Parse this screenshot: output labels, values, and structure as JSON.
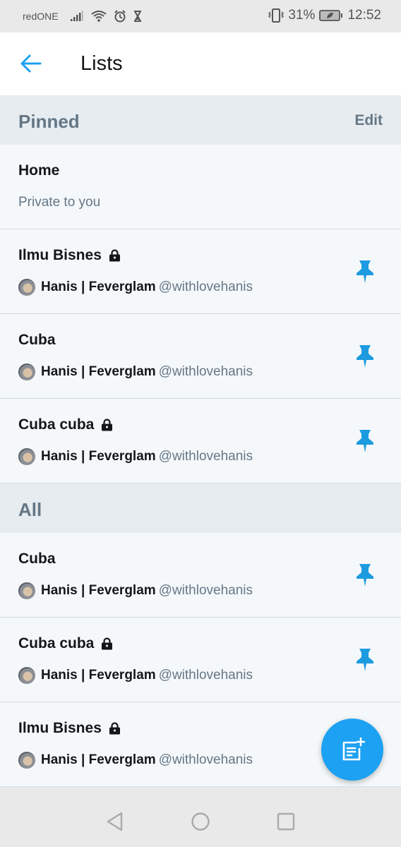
{
  "status_bar": {
    "carrier": "redONE",
    "battery_percent": "31%",
    "time": "12:52",
    "icons": [
      "signal-icon",
      "wifi-icon",
      "alarm-icon",
      "hourglass-icon",
      "vibrate-icon",
      "battery-saver-icon"
    ]
  },
  "header": {
    "title": "Lists",
    "back_icon": "arrow-left-icon"
  },
  "pinned": {
    "title": "Pinned",
    "edit_label": "Edit",
    "items": [
      {
        "title": "Home",
        "subtitle": "Private to you"
      },
      {
        "title": "Ilmu Bisnes",
        "private": true,
        "owner_name": "Hanis | Feverglam",
        "owner_handle": "@withlovehanis",
        "pinned": true
      },
      {
        "title": "Cuba",
        "private": false,
        "owner_name": "Hanis | Feverglam",
        "owner_handle": "@withlovehanis",
        "pinned": true
      },
      {
        "title": "Cuba cuba",
        "private": true,
        "owner_name": "Hanis | Feverglam",
        "owner_handle": "@withlovehanis",
        "pinned": true
      }
    ]
  },
  "all": {
    "title": "All",
    "items": [
      {
        "title": "Cuba",
        "private": false,
        "owner_name": "Hanis | Feverglam",
        "owner_handle": "@withlovehanis",
        "pinned": true
      },
      {
        "title": "Cuba cuba",
        "private": true,
        "owner_name": "Hanis | Feverglam",
        "owner_handle": "@withlovehanis",
        "pinned": true
      },
      {
        "title": "Ilmu Bisnes",
        "private": true,
        "owner_name": "Hanis | Feverglam",
        "owner_handle": "@withlovehanis",
        "pinned": false
      }
    ]
  },
  "fab": {
    "icon": "new-list-icon"
  },
  "nav_bar": {
    "buttons": [
      "back-nav-icon",
      "home-nav-icon",
      "recents-nav-icon"
    ]
  },
  "colors": {
    "accent": "#1da1f2",
    "pin": "#1d9be0",
    "secondary_text": "#657786",
    "section_bg": "#e6ecf0"
  }
}
